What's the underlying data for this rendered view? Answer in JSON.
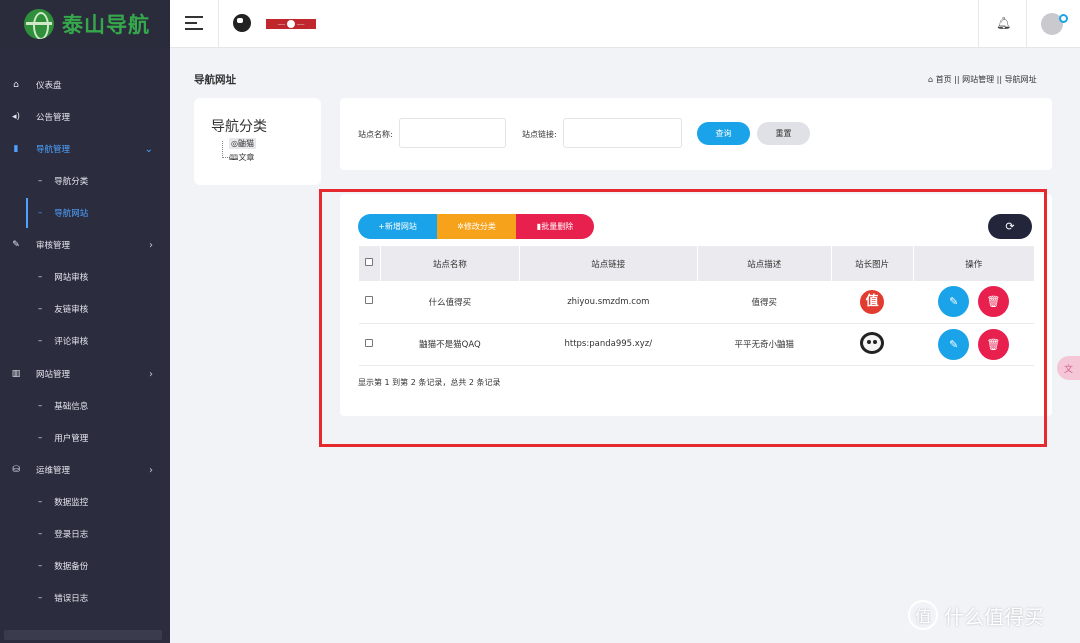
{
  "app": {
    "logo_text": "泰山导航"
  },
  "sidebar": {
    "items": [
      {
        "icon": "home-icon",
        "label": "仪表盘"
      },
      {
        "icon": "speaker-icon",
        "label": "公告管理"
      },
      {
        "icon": "bookmark-icon",
        "label": "导航管理",
        "active": true,
        "expanded": true
      },
      {
        "label": "导航分类",
        "sub": true
      },
      {
        "label": "导航网站",
        "sub": true,
        "active": true
      },
      {
        "icon": "leaf-icon",
        "label": "审核管理",
        "has_arrow": true
      },
      {
        "label": "网站审核",
        "sub": true
      },
      {
        "label": "友链审核",
        "sub": true
      },
      {
        "label": "评论审核",
        "sub": true
      },
      {
        "icon": "columns-icon",
        "label": "网站管理",
        "has_arrow": true
      },
      {
        "label": "基础信息",
        "sub": true
      },
      {
        "label": "用户管理",
        "sub": true
      },
      {
        "icon": "server-icon",
        "label": "运维管理",
        "has_arrow": true
      },
      {
        "label": "数据监控",
        "sub": true
      },
      {
        "label": "登录日志",
        "sub": true
      },
      {
        "label": "数据备份",
        "sub": true
      },
      {
        "label": "错误日志",
        "sub": true
      }
    ]
  },
  "page": {
    "title": "导航网址",
    "breadcrumb": [
      "首页",
      "网站管理",
      "导航网址"
    ]
  },
  "tree": {
    "title": "导航分类",
    "nodes": [
      "鼬猫",
      "文章"
    ]
  },
  "search": {
    "name_label": "站点名称:",
    "link_label": "站点链接:",
    "query_button": "查询",
    "reset_button": "重置"
  },
  "toolbar": {
    "add_button": "+新增网站",
    "edit_category_button": "✲修改分类",
    "batch_delete_button": "▮批量删除"
  },
  "table": {
    "columns": [
      "站点名称",
      "站点链接",
      "站点描述",
      "站长图片",
      "操作"
    ],
    "rows": [
      {
        "name": "什么值得买",
        "link": "zhiyou.smzdm.com",
        "desc": "值得买",
        "image": "zhi-logo-icon",
        "image_text": "值"
      },
      {
        "name": "鼬猫不是猫QAQ",
        "link": "https:panda995.xyz/",
        "desc": "平平无奇小鼬猫",
        "image": "panda-avatar-icon"
      }
    ],
    "summary": "显示第 1 到第 2 条记录，总共 2 条记录"
  },
  "colors": {
    "sidebar_bg": "#2b2d3f",
    "accent_blue": "#1aa3e8",
    "orange": "#f7a21b",
    "red": "#e8204e",
    "dark_button": "#23263a",
    "highlight_frame": "#e6292c"
  },
  "side_float": {
    "label": "文"
  },
  "watermark": {
    "text": "什么值得买",
    "logo": "值"
  }
}
